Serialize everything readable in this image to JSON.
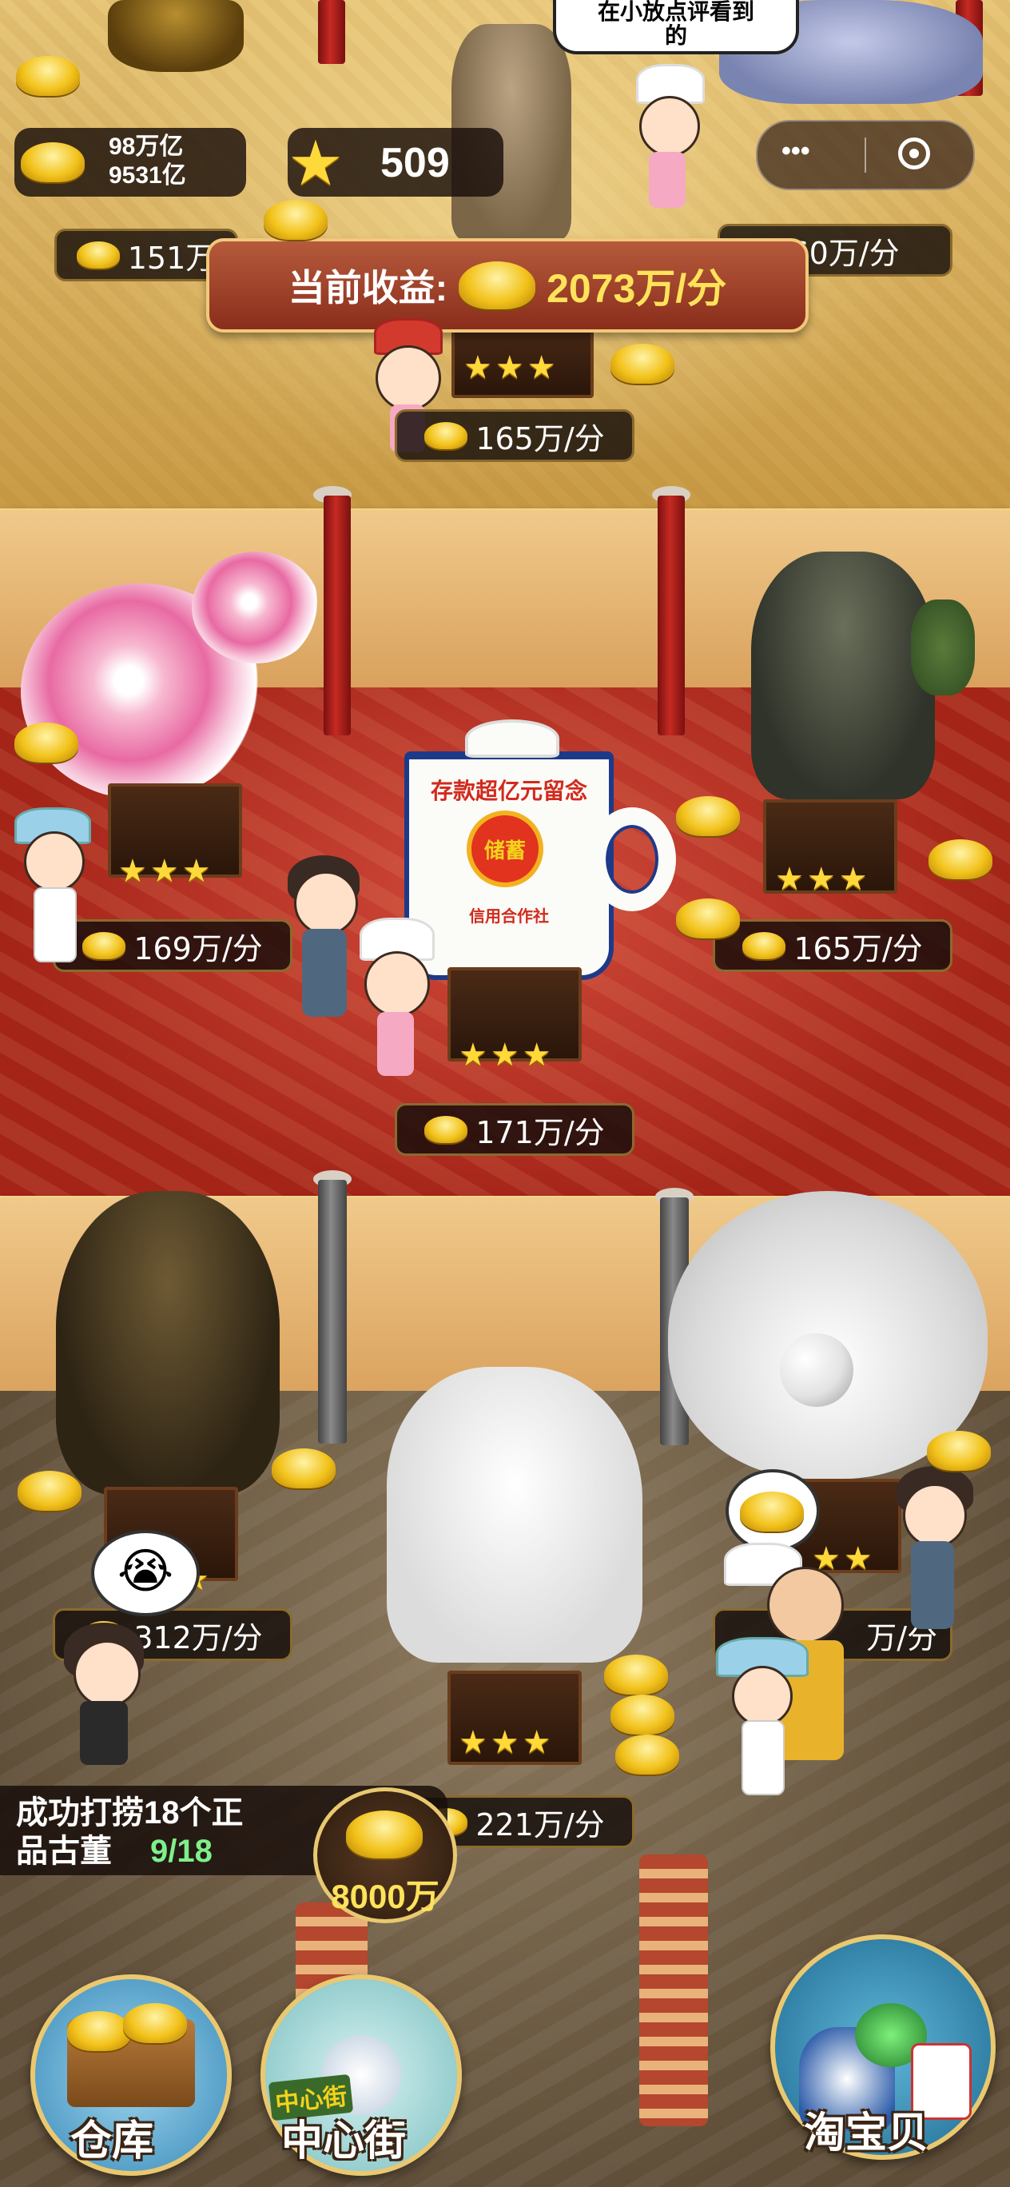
{
  "hud": {
    "gold_line1": "98万亿",
    "gold_line2": "9531亿",
    "stars": "509",
    "menu_dots": "•••"
  },
  "speech_bubble": "在小放点评看到\n的",
  "earnings_banner": {
    "label": "当前收益:",
    "value": "2073万/分"
  },
  "income": {
    "top_left": "151万",
    "top_right": "160万/分",
    "top_center": "165万/分",
    "mid_left": "169万/分",
    "mid_right": "165万/分",
    "mid_center": "171万/分",
    "bot_left": "312万/分",
    "bot_right": "万/分",
    "bot_center": "221万/分"
  },
  "mug_text": {
    "slogan": "存款超亿元留念",
    "seal": "储蓄",
    "org": "信用合作社"
  },
  "task": {
    "line1": "成功打捞18个正",
    "line2": "品古董",
    "progress": "9/18",
    "reward": "8000万"
  },
  "bottom_nav": {
    "warehouse": "仓库",
    "center_street": "中心街",
    "center_street_sign": "中心街",
    "treasure": "淘宝贝"
  },
  "colors": {
    "gold": "#f2c21a",
    "progress_green": "#7ef08a",
    "accent_red": "#c62a22"
  }
}
